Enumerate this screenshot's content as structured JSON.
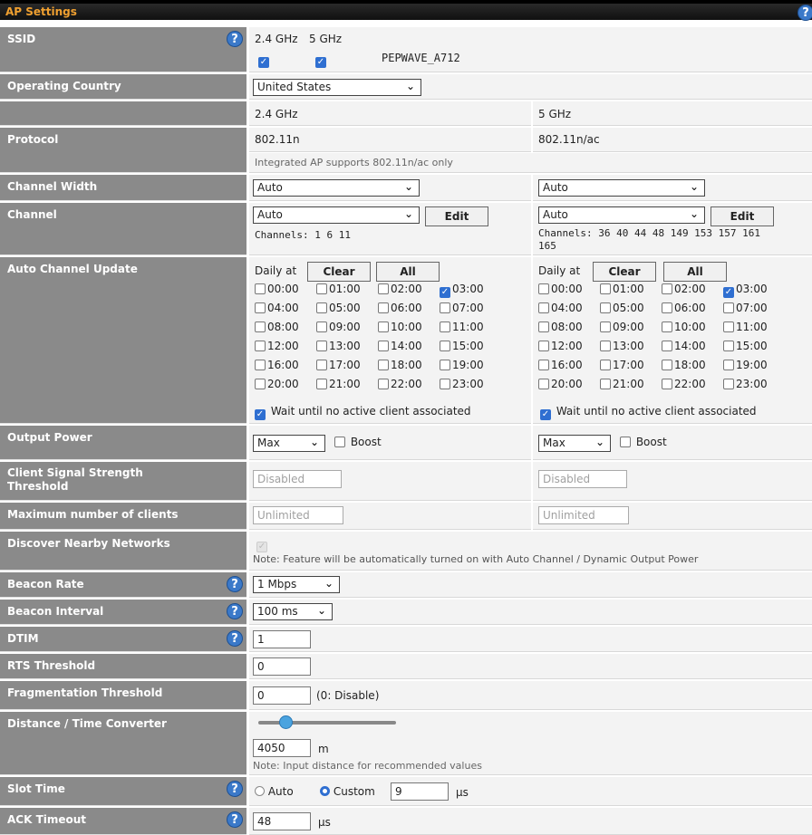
{
  "title": "AP Settings",
  "ssid": {
    "label": "SSID",
    "band1": "2.4 GHz",
    "band2": "5 GHz",
    "name": "PEPWAVE_A712"
  },
  "country": {
    "label": "Operating Country",
    "value": "United States"
  },
  "bands": {
    "b1": "2.4 GHz",
    "b2": "5 GHz"
  },
  "protocol": {
    "label": "Protocol",
    "v1": "802.11n",
    "v2": "802.11n/ac",
    "note": "Integrated AP supports 802.11n/ac only"
  },
  "channel_width": {
    "label": "Channel Width",
    "v1": "Auto",
    "v2": "Auto"
  },
  "channel": {
    "label": "Channel",
    "v1": "Auto",
    "v2": "Auto",
    "edit": "Edit",
    "ch1": "Channels: 1 6 11",
    "ch2a": "Channels: 36 40 44 48 149 153 157 161",
    "ch2b": "165"
  },
  "auto_update": {
    "label": "Auto Channel Update",
    "daily": "Daily at",
    "clear": "Clear",
    "all": "All",
    "hours": [
      "00:00",
      "01:00",
      "02:00",
      "03:00",
      "04:00",
      "05:00",
      "06:00",
      "07:00",
      "08:00",
      "09:00",
      "10:00",
      "11:00",
      "12:00",
      "13:00",
      "14:00",
      "15:00",
      "16:00",
      "17:00",
      "18:00",
      "19:00",
      "20:00",
      "21:00",
      "22:00",
      "23:00"
    ],
    "checked_1": [
      "03:00"
    ],
    "checked_2": [
      "03:00"
    ],
    "wait": "Wait until no active client associated"
  },
  "output_power": {
    "label": "Output Power",
    "v1": "Max",
    "v2": "Max",
    "boost": "Boost"
  },
  "client_signal": {
    "label1": "Client Signal Strength",
    "label2": "Threshold",
    "v1": "Disabled",
    "v2": "Disabled"
  },
  "max_clients": {
    "label": "Maximum number of clients",
    "v1": "Unlimited",
    "v2": "Unlimited"
  },
  "discover": {
    "label": "Discover Nearby Networks",
    "note": "Note: Feature will be automatically turned on with Auto Channel / Dynamic Output Power"
  },
  "beacon_rate": {
    "label": "Beacon Rate",
    "value": "1 Mbps"
  },
  "beacon_interval": {
    "label": "Beacon Interval",
    "value": "100 ms"
  },
  "dtim": {
    "label": "DTIM",
    "value": "1"
  },
  "rts": {
    "label": "RTS Threshold",
    "value": "0"
  },
  "frag": {
    "label": "Fragmentation Threshold",
    "value": "0",
    "hint": "(0: Disable)"
  },
  "distance": {
    "label": "Distance / Time Converter",
    "value": "4050",
    "unit": "m",
    "note": "Note: Input distance for recommended values",
    "slider_fraction": 0.2
  },
  "slot_time": {
    "label": "Slot Time",
    "auto": "Auto",
    "custom": "Custom",
    "value": "9",
    "unit": "µs"
  },
  "ack": {
    "label": "ACK Timeout",
    "value": "48",
    "unit": "µs"
  },
  "icons": {
    "help": "question-circle-icon",
    "check": "checkmark-icon"
  }
}
